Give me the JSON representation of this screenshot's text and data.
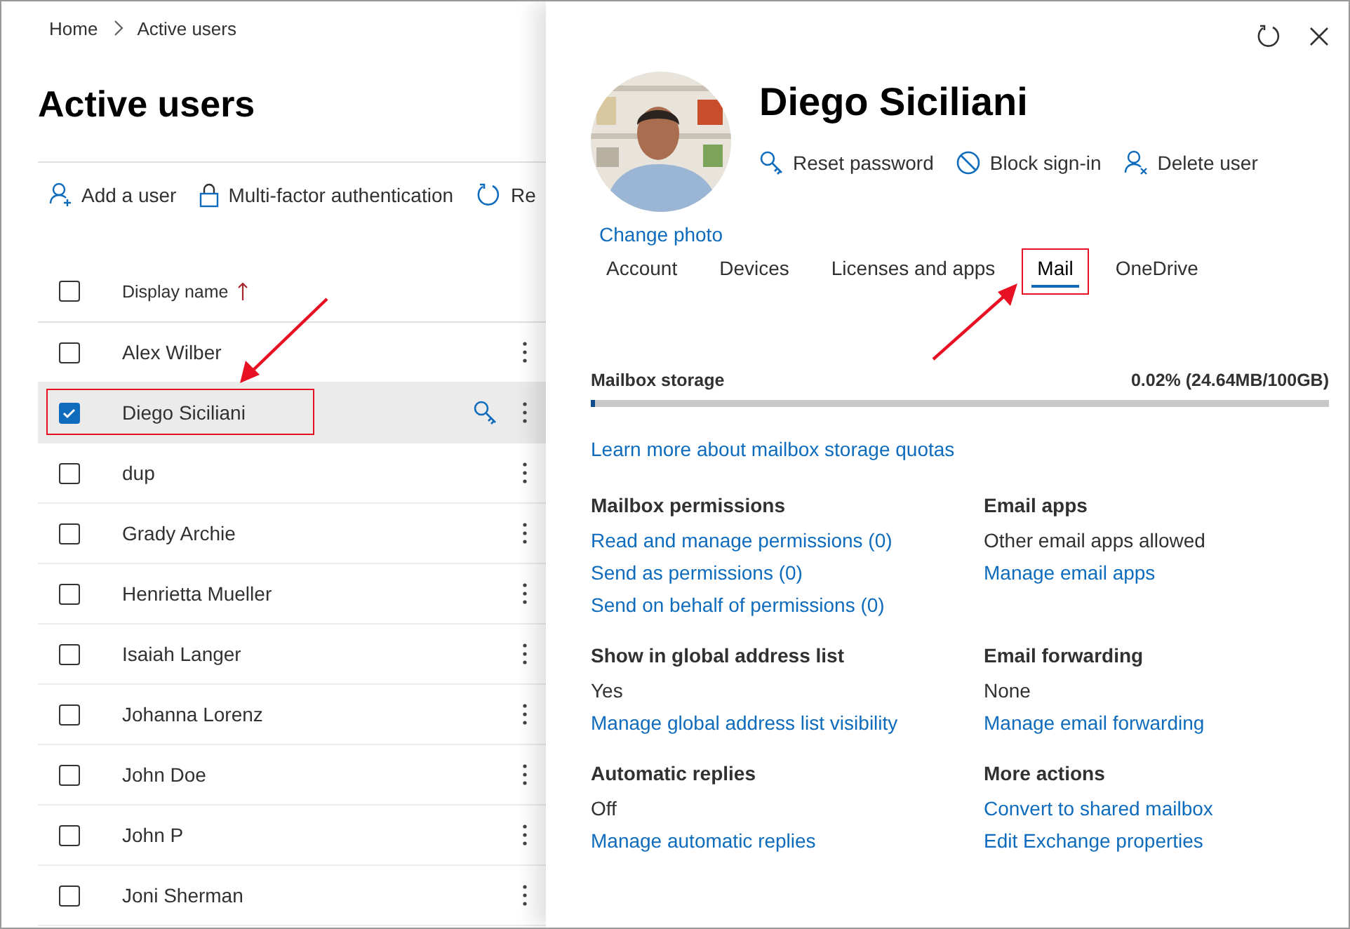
{
  "breadcrumb": [
    "Home",
    "Active users"
  ],
  "page_title": "Active users",
  "toolbar": [
    {
      "label": "Add a user",
      "kind": "add-user"
    },
    {
      "label": "Multi-factor authentication",
      "kind": "lock"
    },
    {
      "label": "Re",
      "kind": "refresh"
    }
  ],
  "table": {
    "columns": [
      {
        "label": "Display name",
        "sorted_ascending": true
      }
    ],
    "header_checked": false,
    "rows": [
      {
        "name": "Alex Wilber",
        "selected": false,
        "highlighted": false
      },
      {
        "name": "Diego Siciliani",
        "selected": true,
        "highlighted": true
      },
      {
        "name": "dup",
        "selected": false,
        "highlighted": false
      },
      {
        "name": "Grady Archie",
        "selected": false,
        "highlighted": false
      },
      {
        "name": "Henrietta Mueller",
        "selected": false,
        "highlighted": false
      },
      {
        "name": "Isaiah Langer",
        "selected": false,
        "highlighted": false
      },
      {
        "name": "Johanna Lorenz",
        "selected": false,
        "highlighted": false
      },
      {
        "name": "John Doe",
        "selected": false,
        "highlighted": false
      },
      {
        "name": "John P",
        "selected": false,
        "highlighted": false
      },
      {
        "name": "Joni Sherman",
        "selected": false,
        "highlighted": false
      }
    ]
  },
  "panel": {
    "user_name": "Diego Siciliani",
    "change_photo": "Change photo",
    "actions": [
      {
        "label": "Reset password",
        "kind": "key"
      },
      {
        "label": "Block sign-in",
        "kind": "block"
      },
      {
        "label": "Delete user",
        "kind": "delete-user"
      }
    ],
    "tabs": [
      {
        "label": "Account",
        "selected": false,
        "highlighted": false
      },
      {
        "label": "Devices",
        "selected": false,
        "highlighted": false
      },
      {
        "label": "Licenses and apps",
        "selected": false,
        "highlighted": false
      },
      {
        "label": "Mail",
        "selected": true,
        "highlighted": true
      },
      {
        "label": "OneDrive",
        "selected": false,
        "highlighted": false
      }
    ],
    "storage": {
      "label": "Mailbox storage",
      "reading": "0.02% (24.64MB/100GB)",
      "level": 0.0002
    },
    "storage_link": "Learn more about mailbox storage quotas",
    "sections": [
      {
        "heading": "Mailbox permissions",
        "items": [
          {
            "text": "Read and manage permissions (0)",
            "kind": "link"
          },
          {
            "text": "Send as permissions (0)",
            "kind": "link"
          },
          {
            "text": "Send on behalf of permissions (0)",
            "kind": "link"
          }
        ]
      },
      {
        "heading": "Email apps",
        "items": [
          {
            "text": "Other email apps allowed",
            "kind": "text"
          },
          {
            "text": "Manage email apps",
            "kind": "link"
          }
        ]
      },
      {
        "heading": "Show in global address list",
        "items": [
          {
            "text": "Yes",
            "kind": "text"
          },
          {
            "text": "Manage global address list visibility",
            "kind": "link"
          }
        ]
      },
      {
        "heading": "Email forwarding",
        "items": [
          {
            "text": "None",
            "kind": "text"
          },
          {
            "text": "Manage email forwarding",
            "kind": "link"
          }
        ]
      },
      {
        "heading": "Automatic replies",
        "items": [
          {
            "text": "Off",
            "kind": "text"
          },
          {
            "text": "Manage automatic replies",
            "kind": "link"
          }
        ]
      },
      {
        "heading": "More actions",
        "items": [
          {
            "text": "Convert to shared mailbox",
            "kind": "link"
          },
          {
            "text": "Edit Exchange properties",
            "kind": "link"
          }
        ]
      }
    ]
  }
}
